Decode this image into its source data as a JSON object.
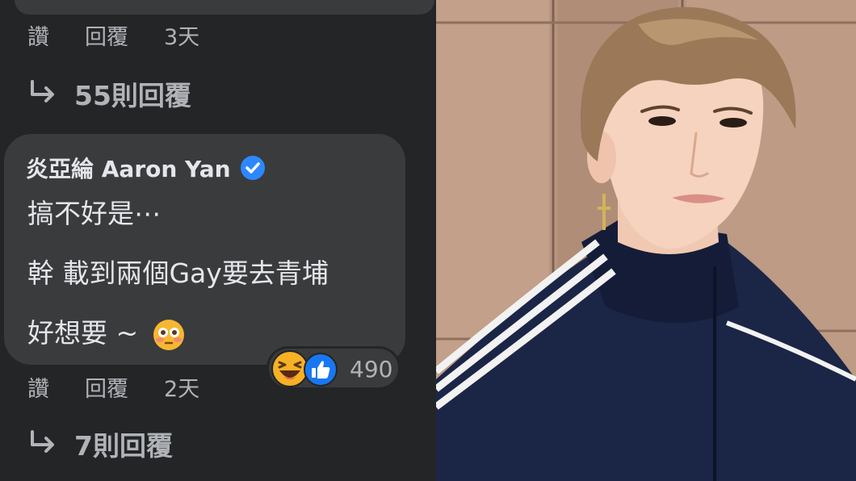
{
  "top_actions": {
    "like": "讚",
    "reply": "回覆",
    "time": "3天"
  },
  "top_replies_link": "55則回覆",
  "comment": {
    "author": "炎亞綸 Aaron Yan",
    "lines": [
      "搞不好是⋯",
      "幹 載到兩個Gay要去青埔",
      "好想要 ~"
    ],
    "emoji": "flushed-face-icon",
    "reactions": {
      "types": [
        "haha-icon",
        "like-icon"
      ],
      "count": "490"
    }
  },
  "bottom_actions": {
    "like": "讚",
    "reply": "回覆",
    "time": "2天"
  },
  "bottom_replies_link": "7則回覆",
  "colors": {
    "panel_bg": "#242526",
    "bubble_bg": "#3a3b3c",
    "text": "#e4e6eb",
    "muted": "#b0b3b8",
    "verified": "#2d88ff",
    "jacket": "#1b2546",
    "wall": "#b79580"
  }
}
